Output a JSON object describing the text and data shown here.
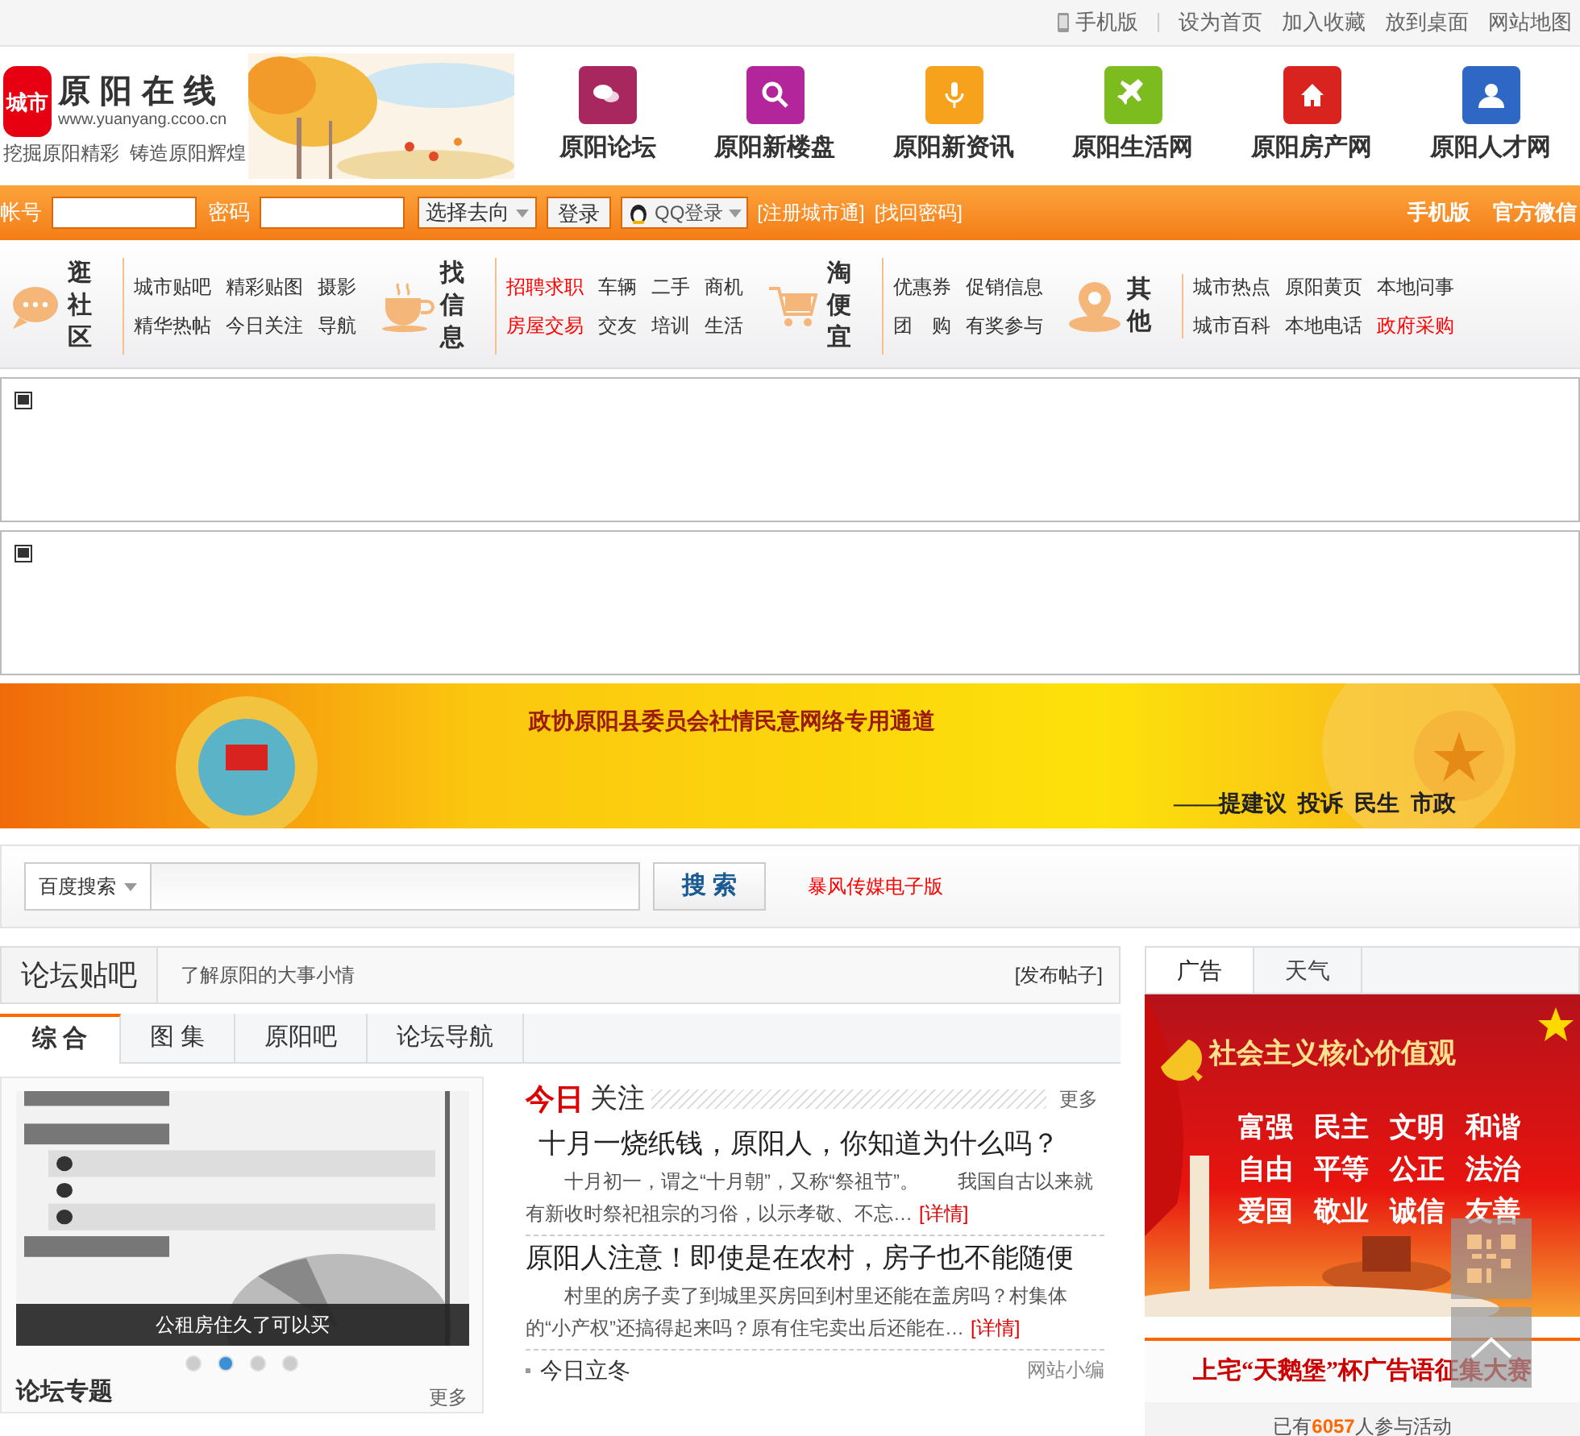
{
  "top_bar": {
    "mobile": "手机版",
    "links": [
      "设为首页",
      "加入收藏",
      "放到桌面",
      "网站地图"
    ]
  },
  "header": {
    "logo": {
      "name": "原阳在线",
      "badge": "城市",
      "url": "www.yuanyang.ccoo.cn",
      "slogan": "挖掘原阳精彩  铸造原阳辉煌"
    },
    "channels": [
      {
        "label": "原阳论坛",
        "color": "#a8275e",
        "kind": "chat"
      },
      {
        "label": "原阳新楼盘",
        "color": "#b3259a",
        "kind": "search"
      },
      {
        "label": "原阳新资讯",
        "color": "#f7a21d",
        "kind": "mic"
      },
      {
        "label": "原阳生活网",
        "color": "#7cbc1e",
        "kind": "plane"
      },
      {
        "label": "原阳房产网",
        "color": "#d9231f",
        "kind": "house"
      },
      {
        "label": "原阳人才网",
        "color": "#2f67c4",
        "kind": "person"
      }
    ]
  },
  "login_bar": {
    "account": "帐号",
    "password": "密码",
    "destination": "选择去向",
    "login": "登录",
    "qq": "QQ登录",
    "links": [
      "[注册城市通]",
      "[找回密码]"
    ],
    "right": [
      "手机版",
      "官方微信"
    ]
  },
  "nav": [
    {
      "title": "逛社区",
      "kind": "chat",
      "links": [
        {
          "text": "城市贴吧",
          "hot": false
        },
        {
          "text": "精彩贴图",
          "hot": false
        },
        {
          "text": "摄影",
          "hot": false
        },
        {
          "text": "精华热帖",
          "hot": false
        },
        {
          "text": "今日关注",
          "hot": false
        },
        {
          "text": "导航",
          "hot": false
        }
      ]
    },
    {
      "title": "找信息",
      "kind": "cup",
      "links": [
        {
          "text": "招聘求职",
          "hot": true
        },
        {
          "text": "车辆",
          "hot": false
        },
        {
          "text": "二手",
          "hot": false
        },
        {
          "text": "商机",
          "hot": false
        },
        {
          "text": "房屋交易",
          "hot": true
        },
        {
          "text": "交友",
          "hot": false
        },
        {
          "text": "培训",
          "hot": false
        },
        {
          "text": "生活",
          "hot": false
        }
      ]
    },
    {
      "title": "淘便宜",
      "kind": "cart",
      "links": [
        {
          "text": "优惠券",
          "hot": false
        },
        {
          "text": "促销信息",
          "hot": false
        },
        {
          "text": "团　购",
          "hot": false
        },
        {
          "text": "有奖参与",
          "hot": false
        }
      ]
    },
    {
      "title": "其他",
      "kind": "pin",
      "links": [
        {
          "text": "城市热点",
          "hot": false
        },
        {
          "text": "原阳黄页",
          "hot": false
        },
        {
          "text": "本地问事",
          "hot": false
        },
        {
          "text": "城市百科",
          "hot": false
        },
        {
          "text": "本地电话",
          "hot": false
        },
        {
          "text": "政府采购",
          "hot": true
        }
      ]
    }
  ],
  "ad_slots": [
    {
      "kind": "broken_image"
    },
    {
      "kind": "broken_image"
    }
  ],
  "banner": {
    "title": "政协原阳县委员会社情民意网络专用通道",
    "subtitle": "——提建议  投诉  民生  市政"
  },
  "search": {
    "engine": "百度搜索",
    "button": "搜 索",
    "link": "暴风传媒电子版"
  },
  "forum": {
    "title": "论坛贴吧",
    "subtitle": "了解原阳的大事小情",
    "action": "[发布帖子]",
    "tabs": [
      {
        "label": "综 合",
        "selected": true
      },
      {
        "label": "图 集",
        "selected": false
      },
      {
        "label": "原阳吧",
        "selected": false
      },
      {
        "label": "论坛导航",
        "selected": false
      }
    ],
    "slide": {
      "caption": "公租房住久了可以买",
      "dots": [
        {
          "selected": false
        },
        {
          "selected": true
        },
        {
          "selected": false
        },
        {
          "selected": false
        }
      ]
    },
    "topics": {
      "title": "论坛专题",
      "more": "更多"
    },
    "today": {
      "title_red": "今日",
      "title": "关注",
      "more": "更多",
      "articles": [
        {
          "title": "十月一烧纸钱，原阳人，你知道为什么吗？",
          "summary": "十月初一，谓之“十月朝”，又称“祭祖节”。　　我国自古以来就有新收时祭祀祖宗的习俗，以示孝敬、不忘…",
          "link": "[详情]"
        },
        {
          "title": "原阳人注意！即使是在农村，房子也不能随便",
          "summary": "村里的房子卖了到城里买房回到村里还能在盖房吗？村集体的“小产权”还搞得起来吗？原有住宅卖出后还能在…",
          "link": "[详情]"
        }
      ],
      "list": [
        {
          "text": "今日立冬",
          "source": "网站小编"
        }
      ]
    }
  },
  "sidebar": {
    "tabs": [
      {
        "label": "广告",
        "selected": true
      },
      {
        "label": "天气",
        "selected": false
      }
    ],
    "ad": {
      "title": "社会主义核心价值观",
      "words": [
        "富强",
        "民主",
        "文明",
        "和谐",
        "自由",
        "平等",
        "公正",
        "法治",
        "爱国",
        "敬业",
        "诚信",
        "友善"
      ]
    },
    "contest": "上宅“天鹅堡”杯广告语征集大赛",
    "participants": "已有**6057**人参与活动"
  }
}
